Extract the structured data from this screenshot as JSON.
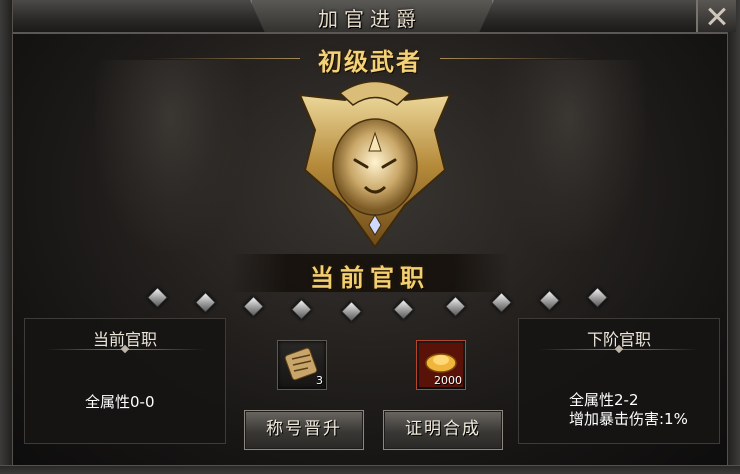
{
  "window": {
    "title": "加官进爵"
  },
  "rank": {
    "name": "初级武者",
    "banner": "当前官职"
  },
  "progress": {
    "total": 10,
    "filled": 0
  },
  "current_panel": {
    "title": "当前官职",
    "attr": "全属性0-0"
  },
  "next_panel": {
    "title": "下阶官职",
    "attr": "全属性2-2",
    "extra": "增加暴击伤害:1%"
  },
  "items": [
    {
      "icon": "scroll-icon",
      "qty": "3"
    },
    {
      "icon": "gold-ingot-icon",
      "qty": "2000"
    }
  ],
  "buttons": {
    "promote": "称号晋升",
    "synthesize": "证明合成"
  },
  "colors": {
    "gold": "#f3d27a",
    "panel": "#161514"
  }
}
